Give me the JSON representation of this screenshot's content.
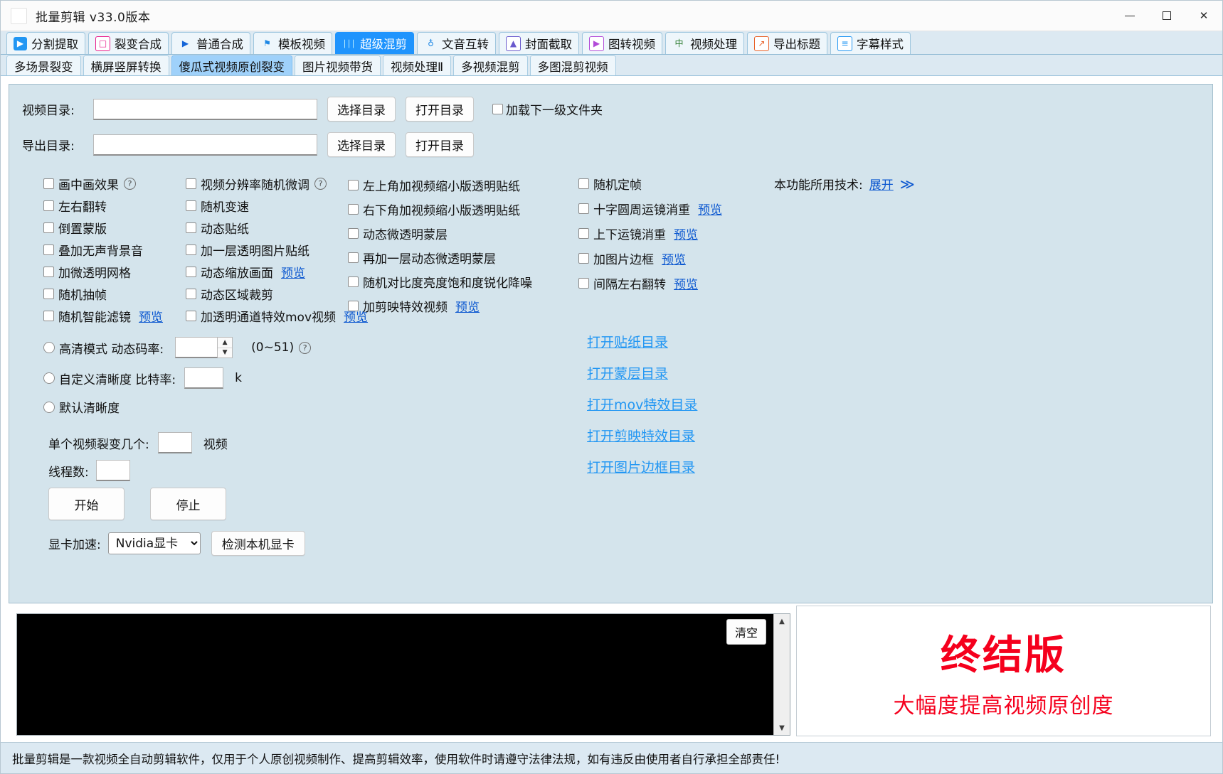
{
  "window": {
    "title": "批量剪辑  v33.0版本",
    "minimize": "—",
    "maximize": "□",
    "close": "✕"
  },
  "main_tabs": [
    {
      "label": "分割提取",
      "icon": "film-play-icon",
      "active": false
    },
    {
      "label": "裂变合成",
      "icon": "copy-squares-icon",
      "active": false
    },
    {
      "label": "普通合成",
      "icon": "play-triangle-icon",
      "active": false
    },
    {
      "label": "模板视频",
      "icon": "bookmark-icon",
      "active": false
    },
    {
      "label": "超级混剪",
      "icon": "waveform-icon",
      "active": true
    },
    {
      "label": "文音互转",
      "icon": "microphone-icon",
      "active": false
    },
    {
      "label": "封面截取",
      "icon": "image-mountain-icon",
      "active": false
    },
    {
      "label": "图转视频",
      "icon": "play-box-icon",
      "active": false
    },
    {
      "label": "视频处理",
      "icon": "chinese-char-icon",
      "active": false
    },
    {
      "label": "导出标题",
      "icon": "chart-note-icon",
      "active": false
    },
    {
      "label": "字幕样式",
      "icon": "subtitle-lines-icon",
      "active": false
    }
  ],
  "sub_tabs": [
    {
      "label": "多场景裂变",
      "active": false
    },
    {
      "label": "横屏竖屏转换",
      "active": false
    },
    {
      "label": "傻瓜式视频原创裂变",
      "active": true
    },
    {
      "label": "图片视频带货",
      "active": false
    },
    {
      "label": "视频处理Ⅱ",
      "active": false
    },
    {
      "label": "多视频混剪",
      "active": false
    },
    {
      "label": "多图混剪视频",
      "active": false
    }
  ],
  "directories": {
    "video": {
      "label": "视频目录:",
      "value": "",
      "select_button": "选择目录",
      "open_button": "打开目录",
      "checkbox_label": "加载下一级文件夹",
      "checked": false
    },
    "export": {
      "label": "导出目录:",
      "value": "",
      "select_button": "选择目录",
      "open_button": "打开目录"
    }
  },
  "tech_note": {
    "label": "本功能所用技术:",
    "link": "展开",
    "chevron": "≫"
  },
  "options_col1": [
    {
      "label": "画中画效果",
      "checked": false,
      "help": true
    },
    {
      "label": "左右翻转",
      "checked": false
    },
    {
      "label": "倒置蒙版",
      "checked": false
    },
    {
      "label": "叠加无声背景音",
      "checked": false
    },
    {
      "label": "加微透明网格",
      "checked": false
    },
    {
      "label": "随机抽帧",
      "checked": false
    },
    {
      "label": "随机智能滤镜",
      "checked": false,
      "preview": "预览"
    }
  ],
  "options_col2": [
    {
      "label": "视频分辨率随机微调",
      "checked": false,
      "help": true
    },
    {
      "label": "随机变速",
      "checked": false
    },
    {
      "label": "动态贴纸",
      "checked": false
    },
    {
      "label": "加一层透明图片贴纸",
      "checked": false
    },
    {
      "label": "动态缩放画面",
      "checked": false,
      "preview": "预览"
    },
    {
      "label": "动态区域裁剪",
      "checked": false
    },
    {
      "label": "加透明通道特效mov视频",
      "checked": false,
      "preview": "预览"
    }
  ],
  "options_col3": [
    {
      "label": "左上角加视频缩小版透明贴纸",
      "checked": false
    },
    {
      "label": "右下角加视频缩小版透明贴纸",
      "checked": false
    },
    {
      "label": "动态微透明蒙层",
      "checked": false
    },
    {
      "label": "再加一层动态微透明蒙层",
      "checked": false
    },
    {
      "label": "随机对比度亮度饱和度锐化降噪",
      "checked": false
    },
    {
      "label": "加剪映特效视频",
      "checked": false,
      "preview": "预览"
    }
  ],
  "options_col4": [
    {
      "label": "随机定帧",
      "checked": false
    },
    {
      "label": "十字圆周运镜消重",
      "checked": false,
      "preview": "预览"
    },
    {
      "label": "上下运镜消重",
      "checked": false,
      "preview": "预览"
    },
    {
      "label": "加图片边框",
      "checked": false,
      "preview": "预览"
    },
    {
      "label": "间隔左右翻转",
      "checked": false,
      "preview": "预览"
    }
  ],
  "quality": {
    "hd": {
      "label": "高清模式 动态码率:",
      "value": "",
      "range_hint": "(0~51)",
      "selected": false
    },
    "custom": {
      "label": "自定义清晰度  比特率:",
      "value": "",
      "unit": "k",
      "selected": false
    },
    "default": {
      "label": "默认清晰度",
      "selected": false
    }
  },
  "split": {
    "label": "单个视频裂变几个:",
    "value": "",
    "suffix": "视频"
  },
  "threads": {
    "label": "线程数:",
    "value": ""
  },
  "actions": {
    "start": "开始",
    "stop": "停止"
  },
  "gpu": {
    "label": "显卡加速:",
    "selected": "Nvidia显卡",
    "options": [
      "Nvidia显卡"
    ],
    "detect_button": "检测本机显卡"
  },
  "open_links": [
    "打开贴纸目录",
    "打开蒙层目录",
    "打开mov特效目录",
    "打开剪映特效目录",
    "打开图片边框目录"
  ],
  "console": {
    "text": "",
    "clear_button": "清空",
    "scroll_up": "▲",
    "scroll_down": "▼"
  },
  "promo": {
    "title": "终结版",
    "subtitle": "大幅度提高视频原创度",
    "color": "#f5001d"
  },
  "status_bar": {
    "text": "批量剪辑是一款视频全自动剪辑软件，仅用于个人原创视频制作、提高剪辑效率，使用软件时请遵守法律法规，如有违反由使用者自行承担全部责任!"
  },
  "colors": {
    "accent": "#1f94fd",
    "link": "#0b57d0",
    "panel": "#d4e4ec",
    "promo_red": "#f5001d"
  }
}
